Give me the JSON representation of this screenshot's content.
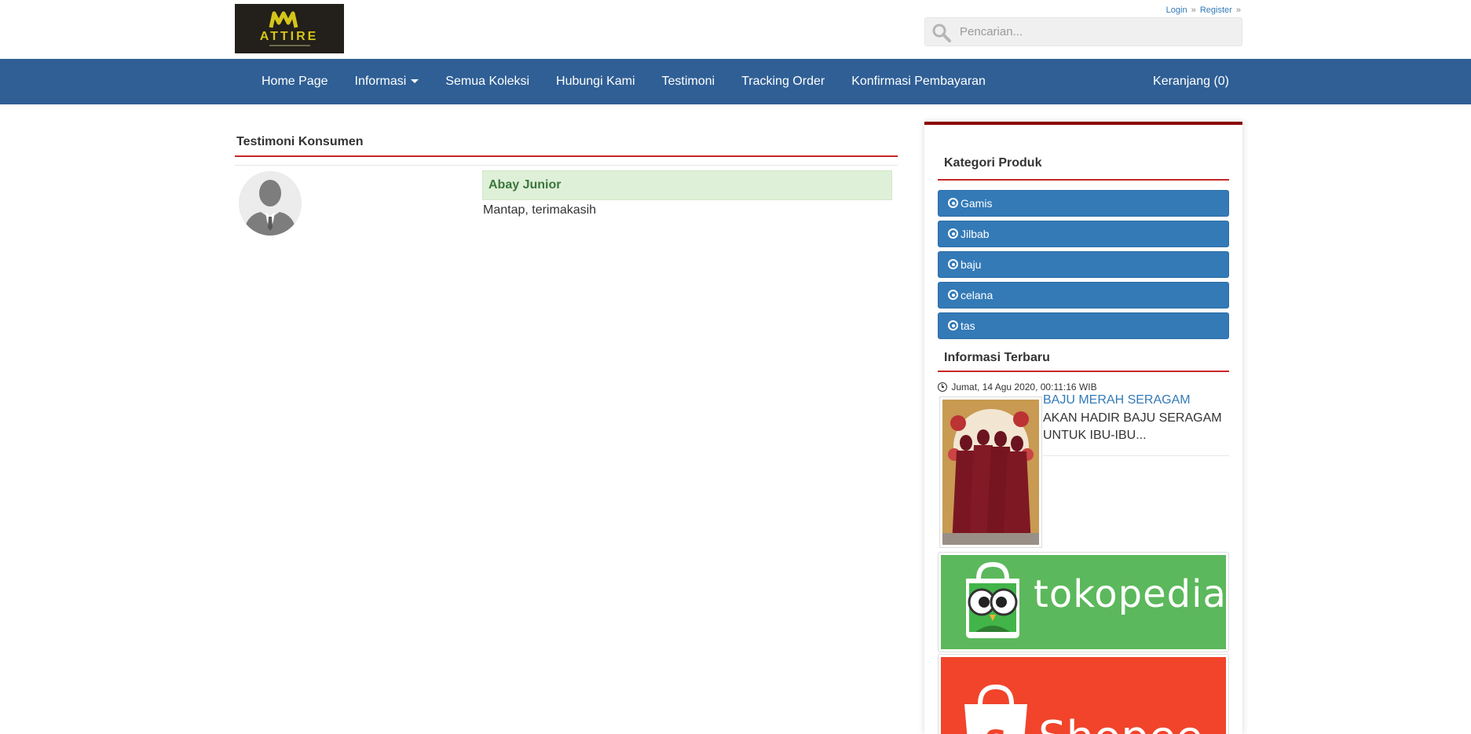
{
  "header": {
    "logo_text": "ATTIRE",
    "login_label": "Login",
    "register_label": "Register",
    "separator": "»",
    "search_placeholder": "Pencarian..."
  },
  "nav": {
    "items": [
      {
        "label": "Home Page"
      },
      {
        "label": "Informasi",
        "has_dropdown": true
      },
      {
        "label": "Semua Koleksi"
      },
      {
        "label": "Hubungi Kami"
      },
      {
        "label": "Testimoni"
      },
      {
        "label": "Tracking Order"
      },
      {
        "label": "Konfirmasi Pembayaran"
      }
    ],
    "cart_label": "Keranjang (0)",
    "color": "#2f5f95"
  },
  "main": {
    "title": "Testimoni Konsumen",
    "testimonial": {
      "name": "Abay Junior",
      "text": "Mantap, terimakasih"
    }
  },
  "sidebar": {
    "categories_title": "Kategori Produk",
    "categories": [
      "Gamis",
      "Jilbab",
      "baju",
      "celana",
      "tas"
    ],
    "news_title": "Informasi Terbaru",
    "news": {
      "date": "Jumat, 14 Agu 2020, 00:11:16 WIB",
      "title": "BAJU MERAH SERAGAM",
      "excerpt": "AKAN HADIR BAJU SERAGAM UNTUK IBU-IBU..."
    },
    "banners": {
      "tokopedia": "tokopedia",
      "shopee": "Shopee"
    },
    "accent_color": "#c62828",
    "button_color": "#337ab7"
  }
}
